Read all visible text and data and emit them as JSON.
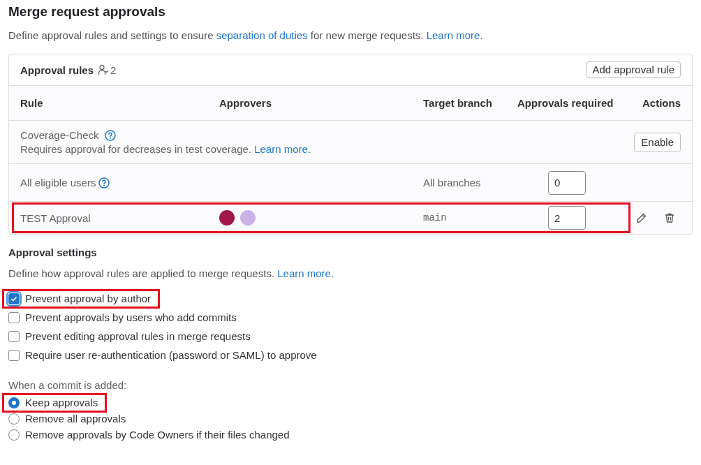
{
  "page_title": "Merge request approvals",
  "description": {
    "before": "Define approval rules and settings to ensure ",
    "link": "separation of duties",
    "after": " for new merge requests. ",
    "link_2": "Learn more."
  },
  "approval_rules": {
    "title": "Approval rules",
    "count": "2",
    "add_button": "Add approval rule",
    "columns": [
      "Rule",
      "Approvers",
      "Target branch",
      "Approvals required",
      "Actions"
    ],
    "rows": [
      {
        "kind": "coverage",
        "name": "Coverage-Check",
        "help": true,
        "description": "Requires approval for decreases in test coverage. ",
        "link": "Learn more",
        "after_link": ".",
        "action_button": "Enable",
        "highlighted": false
      },
      {
        "kind": "rule",
        "name": "All eligible users",
        "help": true,
        "approvers": [],
        "target": {
          "text": "All branches",
          "kind": "text"
        },
        "approvals": "0",
        "editable": false,
        "highlighted": false
      },
      {
        "kind": "rule",
        "name": "TEST Approval",
        "help": false,
        "approvers": [
          {
            "color": "#a0164b"
          },
          {
            "color": "#c9b3e6"
          }
        ],
        "target": {
          "text": "main",
          "kind": "code"
        },
        "approvals": "2",
        "editable": true,
        "highlighted": true
      }
    ]
  },
  "settings": {
    "title": "Approval settings",
    "description": "Define how approval rules are applied to merge requests. ",
    "link": "Learn more.",
    "checkboxes": [
      {
        "label": "Prevent approval by author",
        "checked": true,
        "focused": true,
        "highlighted": true
      },
      {
        "label": "Prevent approvals by users who add commits",
        "checked": false,
        "focused": false,
        "highlighted": false
      },
      {
        "label": "Prevent editing approval rules in merge requests",
        "checked": false,
        "focused": false,
        "highlighted": false
      },
      {
        "label": "Require user re-authentication (password or SAML) to approve",
        "checked": false,
        "focused": false,
        "highlighted": false
      }
    ],
    "commit": {
      "label": "When a commit is added:",
      "options": [
        {
          "label": "Keep approvals",
          "selected": true,
          "highlighted": true
        },
        {
          "label": "Remove all approvals",
          "selected": false,
          "highlighted": false
        },
        {
          "label": "Remove approvals by Code Owners if their files changed",
          "selected": false,
          "highlighted": false
        }
      ]
    }
  }
}
